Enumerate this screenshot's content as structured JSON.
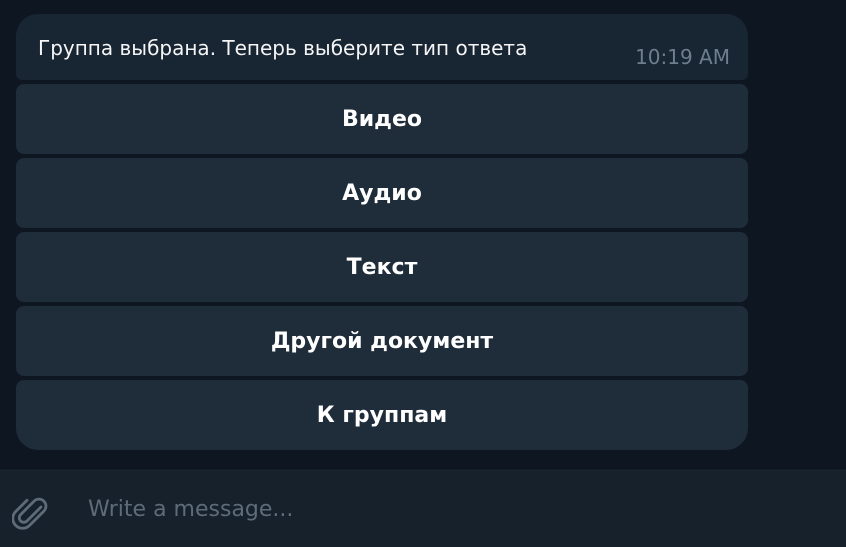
{
  "message": {
    "text": "Группа выбрана. Теперь выберите тип ответа",
    "time": "10:19 AM"
  },
  "buttons": [
    {
      "label": "Видео"
    },
    {
      "label": "Аудио"
    },
    {
      "label": "Текст"
    },
    {
      "label": "Другой документ"
    },
    {
      "label": "К группам"
    }
  ],
  "composer": {
    "placeholder": "Write a message..."
  },
  "colors": {
    "chat_background": "#0e1621",
    "bubble_background": "#182533",
    "button_background": "#1f2c3a",
    "composer_background": "#17212b",
    "time_color": "#6d7f8f",
    "placeholder_color": "#5e6b78"
  },
  "icons": {
    "attach": "paperclip-icon"
  }
}
